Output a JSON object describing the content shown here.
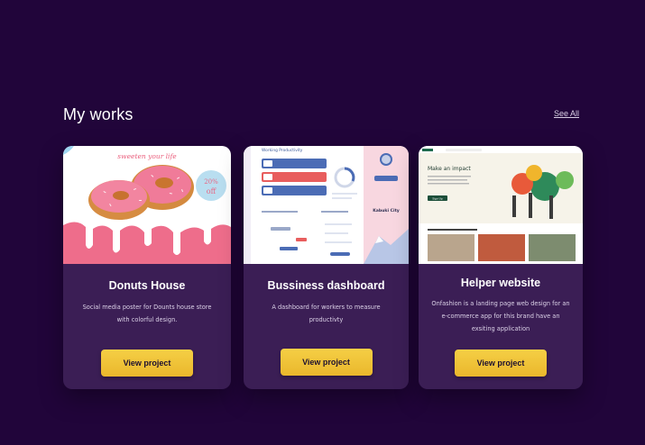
{
  "section": {
    "title": "My works",
    "see_all": "See All"
  },
  "projects": [
    {
      "title": "Donuts House",
      "description": "Social media poster for Dounts house store with colorful design.",
      "button": "View project",
      "thumb": {
        "tagline": "sweeten your life",
        "discount": "20% off"
      }
    },
    {
      "title": "Bussiness dashboard",
      "description": "A dashboard for workers to measure productivty",
      "button": "View project",
      "thumb": {
        "heading": "Working Productivity",
        "city": "Kabuki City"
      }
    },
    {
      "title": "Helper website",
      "description": "Onfashion is a landing page web design for an e-commerce app for this brand have an exsiting application",
      "button": "View project",
      "thumb": {
        "headline": "Make an impact",
        "cta": "Sign Up"
      }
    }
  ],
  "colors": {
    "background": "#21053a",
    "card": "#3b1e55",
    "button": "#f0c23a",
    "donut_pink": "#ee6d8b"
  }
}
